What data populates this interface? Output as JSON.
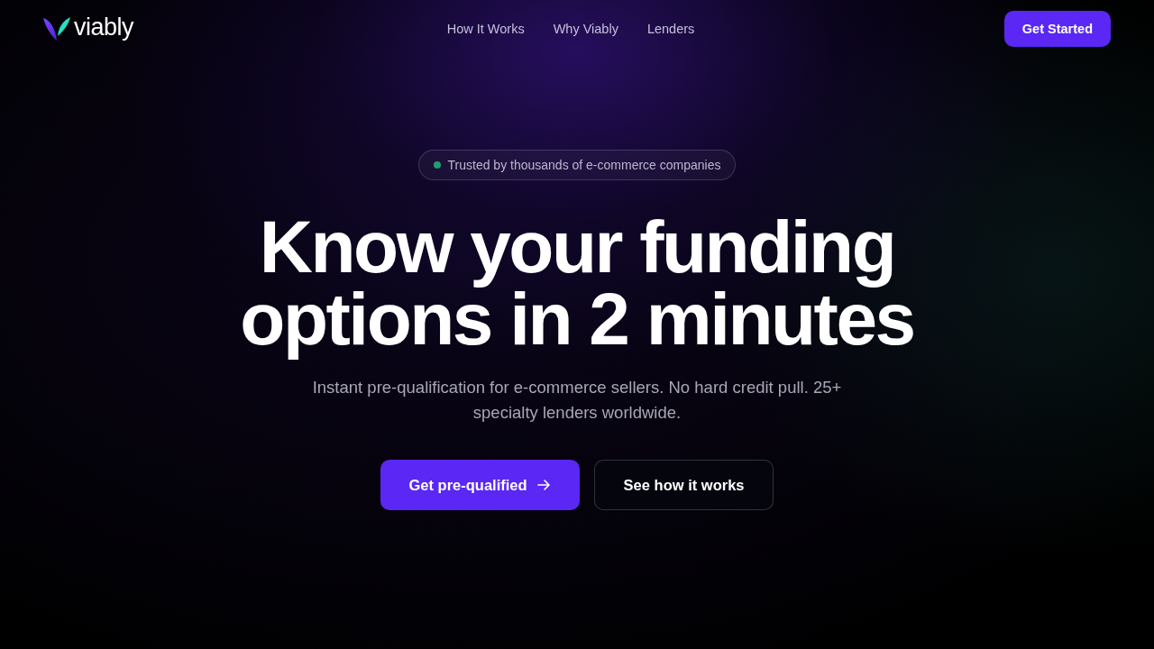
{
  "header": {
    "logo": {
      "wordmark": "viably"
    },
    "nav_links": [
      "How It Works",
      "Why Viably",
      "Lenders"
    ],
    "cta": "Get Started"
  },
  "hero": {
    "badge": "Trusted by thousands of e-commerce companies",
    "heading": "Know your funding options in 2 minutes",
    "subtitle": "Instant pre-qualification for e-commerce sellers. No hard credit pull. 25+ specialty lenders worldwide.",
    "buttons": [
      {
        "label": "Get pre-qualified",
        "kind": "primary"
      },
      {
        "label": "See how it works",
        "kind": "secondary"
      }
    ]
  }
}
